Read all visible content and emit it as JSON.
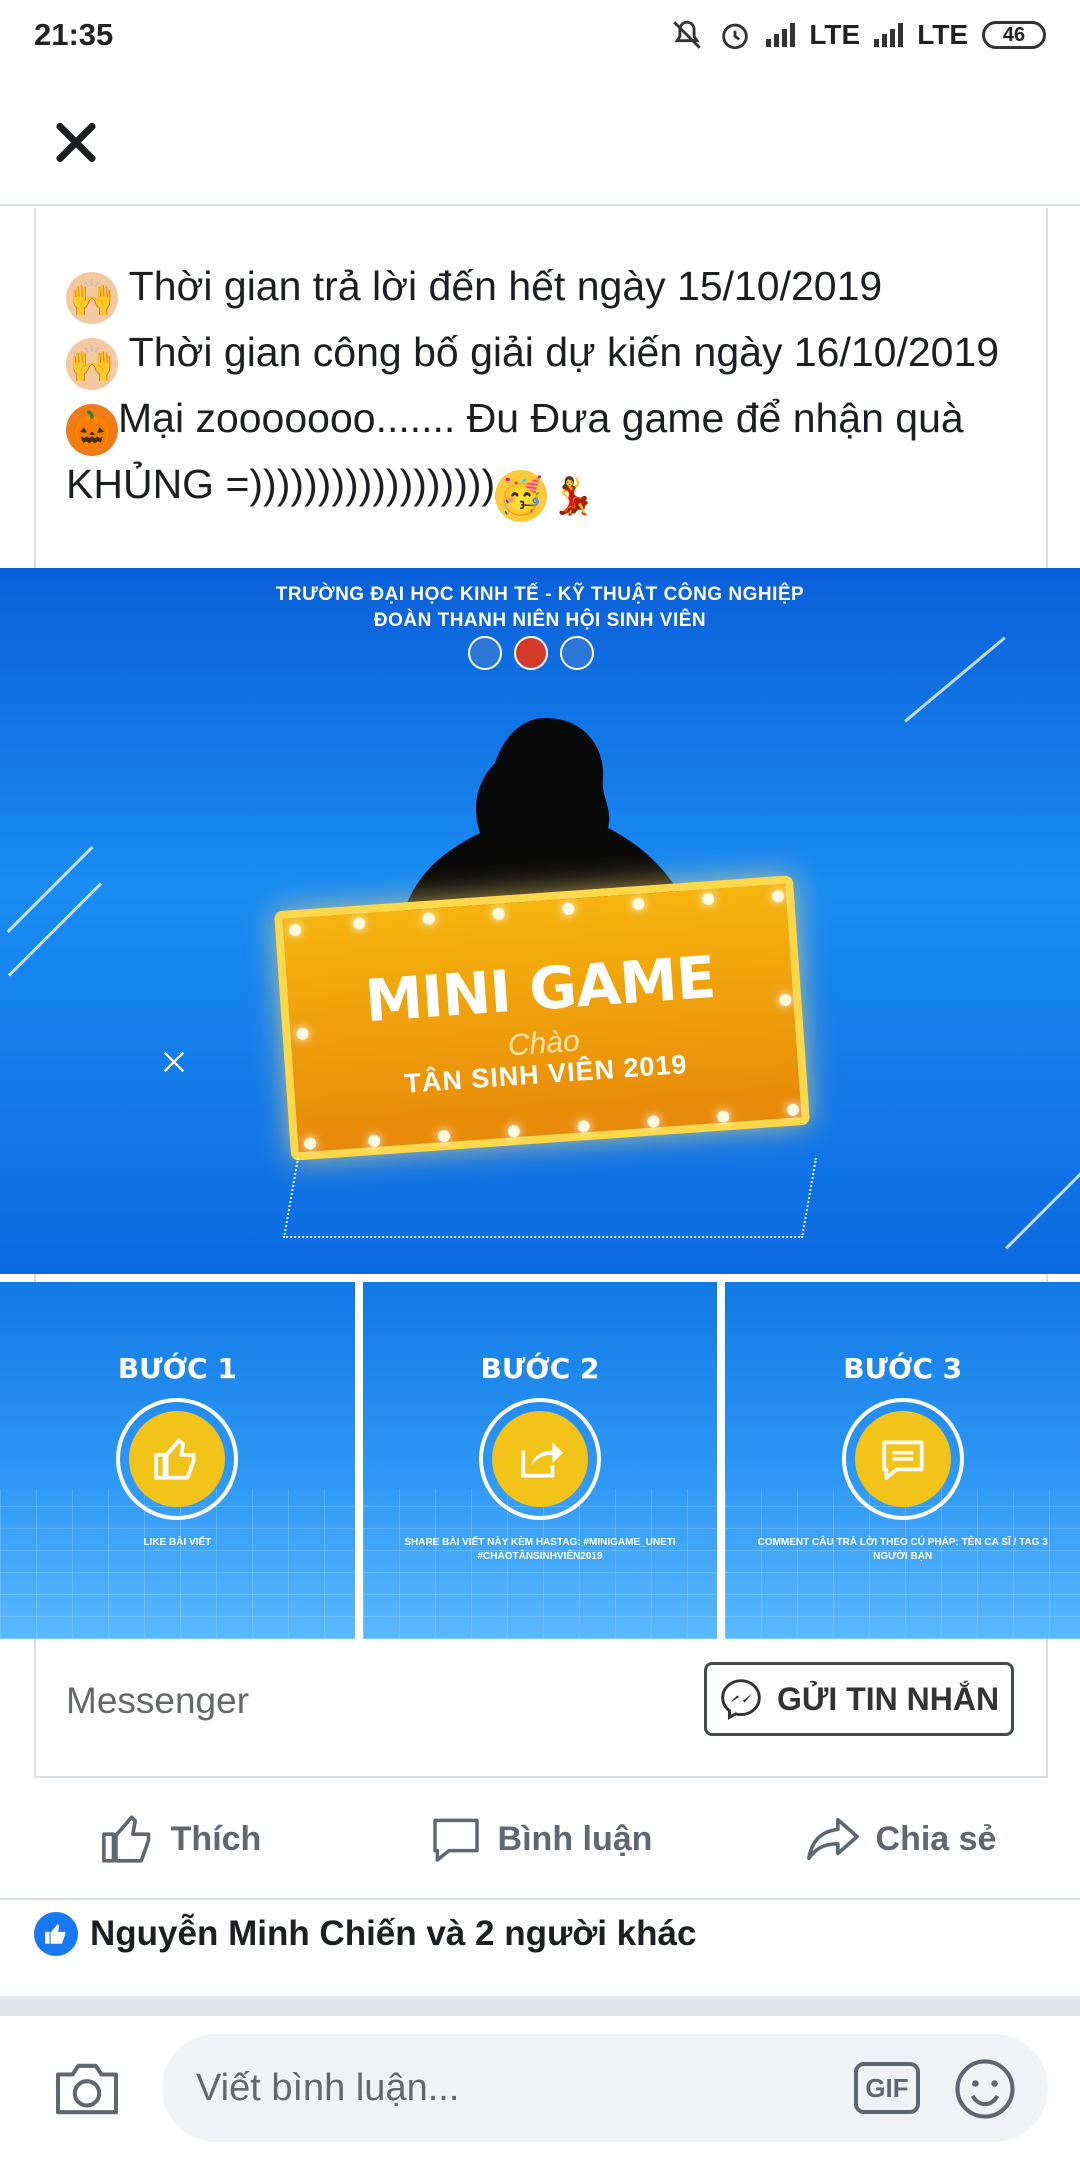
{
  "status_bar": {
    "time": "21:35",
    "network_1": "LTE",
    "network_2": "LTE",
    "battery": "46",
    "icons": [
      "mute-icon",
      "alarm-icon",
      "signal-icon",
      "battery-icon"
    ]
  },
  "topbar": {
    "close_icon": "close-icon"
  },
  "post": {
    "lines": [
      "Thời gian trả lời đến hết ngày 15/10/2019",
      "Thời gian công bố giải dự kiến ngày 16/10/2019",
      "Mại zooooooo....... Đu Đưa game để nhận quà KHỦNG =))))))))))))))))))"
    ],
    "emojis": [
      "raising-hands-emoji",
      "jack-o-lantern-emoji",
      "partying-face-emoji",
      "dancer-emoji"
    ]
  },
  "banner": {
    "header_line_1": "TRƯỜNG ĐẠI HỌC KINH TẾ - KỸ THUẬT CÔNG NGHIỆP",
    "header_line_2": "ĐOÀN THANH NIÊN HỘI SINH VIÊN",
    "title": "MINI GAME",
    "script": "Chào",
    "subtitle": "TÂN SINH VIÊN 2019"
  },
  "steps": [
    {
      "title": "BƯỚC 1",
      "icon": "thumbs-up-icon",
      "desc": "LIKE BÀI VIẾT"
    },
    {
      "title": "BƯỚC 2",
      "icon": "share-icon",
      "desc": "SHARE BÀI VIẾT NÀY KÈM HASTAG: #MINIGAME_UNETI #CHÀOTÂNSINHVIÊN2019"
    },
    {
      "title": "BƯỚC 3",
      "icon": "comment-icon",
      "desc": "COMMENT CÂU TRẢ LỜI THEO CÚ PHÁP: TÊN CA SĨ / TAG 3 NGƯỜI BẠN"
    }
  ],
  "messenger": {
    "label": "Messenger",
    "button_label": "GỬI TIN NHẮN"
  },
  "actions": [
    {
      "label": "Thích",
      "icon": "like-icon"
    },
    {
      "label": "Bình luận",
      "icon": "comment-icon"
    },
    {
      "label": "Chia sẻ",
      "icon": "share-icon"
    }
  ],
  "reactions": {
    "text": "Nguyễn Minh Chiến và 2 người khác"
  },
  "comment_bar": {
    "placeholder": "Viết bình luận...",
    "gif_label": "GIF"
  },
  "colors": {
    "facebook_blue": "#1877f2",
    "banner_blue": "#1a8cf3",
    "marquee_gold": "#f6b40e",
    "step_yellow": "#f2c318",
    "text_dark": "#1c1e21",
    "text_muted": "#65676b"
  }
}
